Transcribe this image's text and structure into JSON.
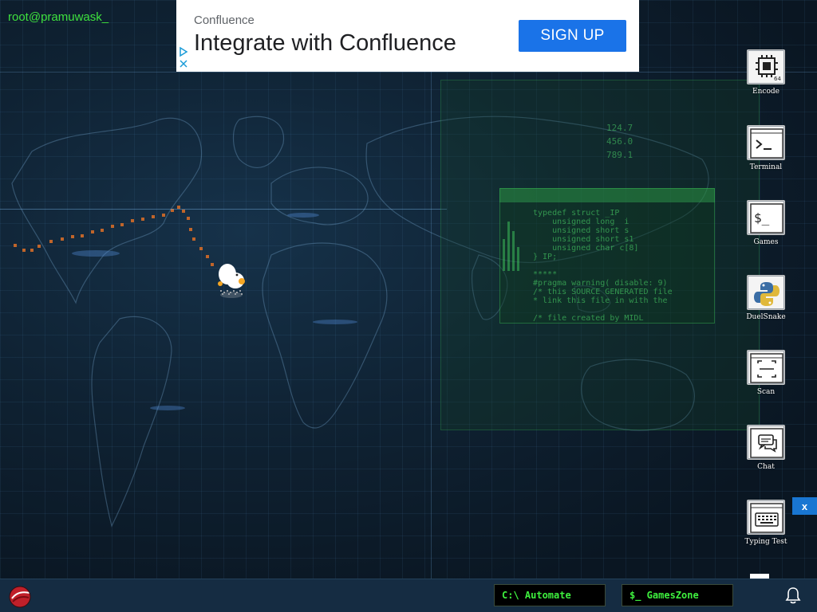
{
  "user": {
    "prompt": "root@pramuwask_"
  },
  "ad": {
    "brand": "Confluence",
    "headline": "Integrate with Confluence",
    "cta": "SIGN UP",
    "choices_icon": "ad-choices-icon"
  },
  "desktop_icons": [
    {
      "label": "Encode",
      "icon": "cpu-icon"
    },
    {
      "label": "Terminal",
      "icon": "terminal-icon"
    },
    {
      "label": "Games",
      "icon": "shell-prompt-icon"
    },
    {
      "label": "DuelSnake",
      "icon": "python-icon"
    },
    {
      "label": "Scan",
      "icon": "scan-icon"
    },
    {
      "label": "Chat",
      "icon": "chat-icon"
    },
    {
      "label": "Typing Test",
      "icon": "keyboard-icon"
    }
  ],
  "close_ad": {
    "label": "x"
  },
  "taskbar": {
    "automate_label": "C:\\ Automate",
    "gameszone_label": "$_ GamesZone",
    "start_icon": "logo-icon",
    "notification_icon": "bell-icon"
  },
  "background": {
    "terminal_text": [
      "typedef struct _IP",
      "    unsigned long  i",
      "    unsigned short s",
      "    unsigned short s1",
      "    unsigned char c[8]",
      "} IP;",
      "",
      "*****",
      "#pragma warning( disable: 9)",
      "/* this SOURCE GENERATED file",
      "* link this file in with the",
      "",
      "/* file created by MIDL"
    ],
    "numbers": [
      "124.7",
      "456.0",
      "789.1"
    ]
  },
  "colors": {
    "accent_green": "#3ee03e",
    "ad_blue": "#1a73e8",
    "taskbar": "#152c42"
  }
}
